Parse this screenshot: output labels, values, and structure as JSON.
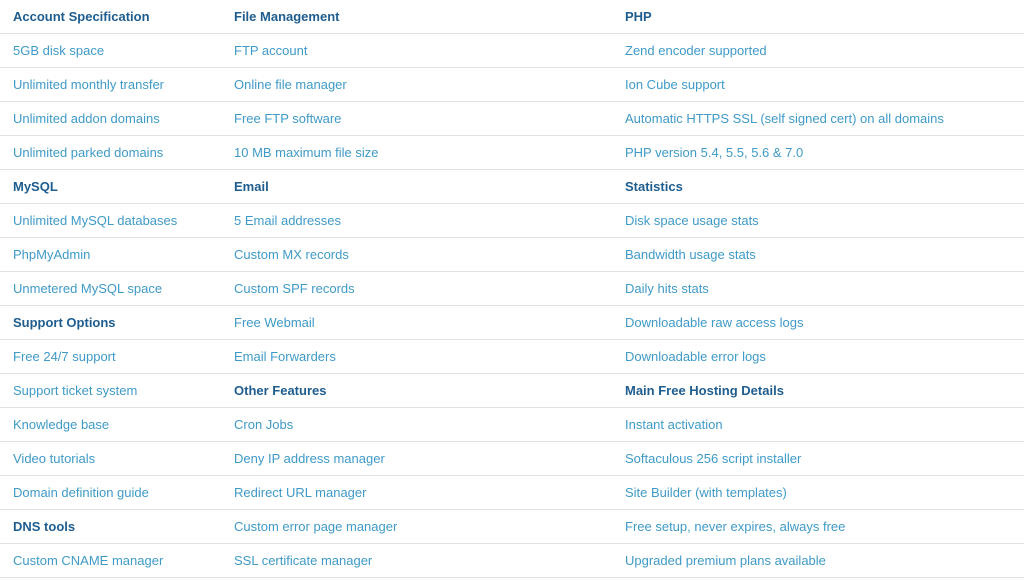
{
  "colors": {
    "heading": "#1f5d8f",
    "item": "#3f9ac7",
    "divider": "#dfe3e8"
  },
  "rows": [
    [
      {
        "t": "Account Specification",
        "h": true
      },
      {
        "t": "File Management",
        "h": true
      },
      {
        "t": "PHP",
        "h": true
      }
    ],
    [
      {
        "t": "5GB disk space"
      },
      {
        "t": "FTP account"
      },
      {
        "t": "Zend encoder supported"
      }
    ],
    [
      {
        "t": "Unlimited monthly transfer"
      },
      {
        "t": "Online file manager"
      },
      {
        "t": "Ion Cube support"
      }
    ],
    [
      {
        "t": "Unlimited addon domains"
      },
      {
        "t": "Free FTP software"
      },
      {
        "t": "Automatic HTTPS SSL (self signed cert) on all domains"
      }
    ],
    [
      {
        "t": "Unlimited parked domains"
      },
      {
        "t": "10 MB maximum file size"
      },
      {
        "t": "PHP version 5.4, 5.5, 5.6 & 7.0"
      }
    ],
    [
      {
        "t": "MySQL",
        "h": true
      },
      {
        "t": "Email",
        "h": true
      },
      {
        "t": "Statistics",
        "h": true
      }
    ],
    [
      {
        "t": "Unlimited MySQL databases"
      },
      {
        "t": "5 Email addresses"
      },
      {
        "t": "Disk space usage stats"
      }
    ],
    [
      {
        "t": "PhpMyAdmin"
      },
      {
        "t": "Custom MX records"
      },
      {
        "t": "Bandwidth usage stats"
      }
    ],
    [
      {
        "t": "Unmetered MySQL space"
      },
      {
        "t": "Custom SPF records"
      },
      {
        "t": "Daily hits stats"
      }
    ],
    [
      {
        "t": "Support Options",
        "h": true
      },
      {
        "t": "Free Webmail"
      },
      {
        "t": "Downloadable raw access logs"
      }
    ],
    [
      {
        "t": "Free 24/7 support"
      },
      {
        "t": "Email Forwarders"
      },
      {
        "t": "Downloadable error logs"
      }
    ],
    [
      {
        "t": "Support ticket system"
      },
      {
        "t": "Other Features",
        "h": true
      },
      {
        "t": "Main Free Hosting Details",
        "h": true
      }
    ],
    [
      {
        "t": "Knowledge base"
      },
      {
        "t": "Cron Jobs"
      },
      {
        "t": "Instant activation"
      }
    ],
    [
      {
        "t": "Video tutorials"
      },
      {
        "t": "Deny IP address manager"
      },
      {
        "t": "Softaculous 256 script installer"
      }
    ],
    [
      {
        "t": "Domain definition guide"
      },
      {
        "t": "Redirect URL manager"
      },
      {
        "t": "Site Builder (with templates)"
      }
    ],
    [
      {
        "t": "DNS tools",
        "h": true
      },
      {
        "t": "Custom error page manager"
      },
      {
        "t": "Free setup, never expires, always free"
      }
    ],
    [
      {
        "t": "Custom CNAME manager"
      },
      {
        "t": "SSL certificate manager"
      },
      {
        "t": "Upgraded premium plans available"
      }
    ]
  ]
}
